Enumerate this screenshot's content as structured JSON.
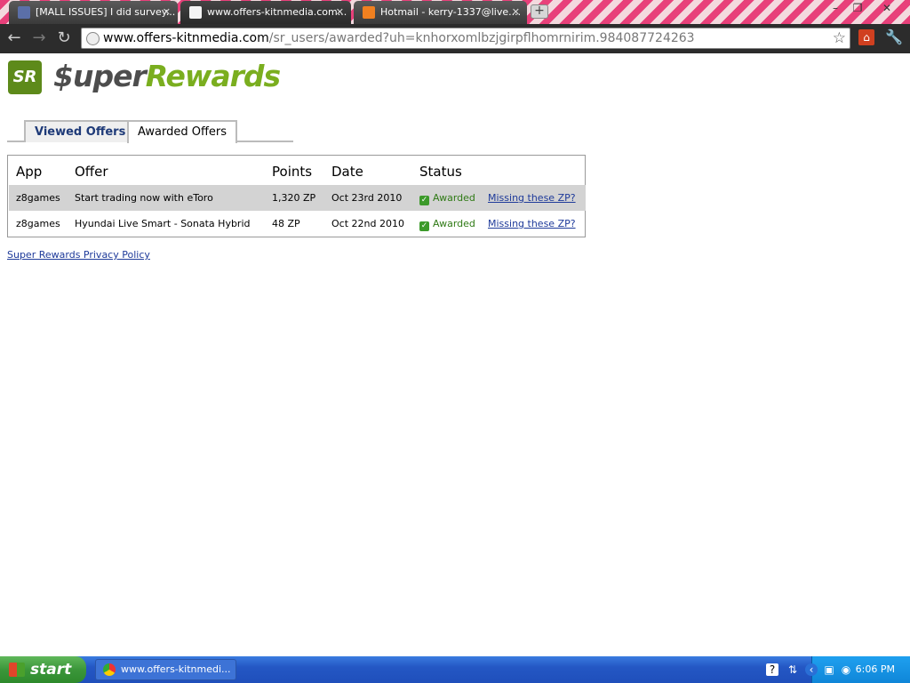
{
  "browser": {
    "tabs": [
      {
        "title": "[MALL ISSUES] I did survey...",
        "active": false
      },
      {
        "title": "www.offers-kitnmedia.com...",
        "active": true
      },
      {
        "title": "Hotmail - kerry-1337@live....",
        "active": false
      }
    ],
    "url_host": "www.offers-kitnmedia.com",
    "url_path": "/sr_users/awarded?uh=knhorxomlbzjgirpflhomrnirim.984087724263"
  },
  "logo": {
    "badge": "SR",
    "super": "$uper",
    "rewards": "Rewards"
  },
  "tabs": {
    "viewed": "Viewed Offers",
    "awarded": "Awarded Offers"
  },
  "table": {
    "headers": {
      "app": "App",
      "offer": "Offer",
      "points": "Points",
      "date": "Date",
      "status": "Status"
    },
    "rows": [
      {
        "app": "z8games",
        "offer": "Start trading now with eToro",
        "points": "1,320 ZP",
        "date": "Oct 23rd 2010",
        "status": "Awarded",
        "link": "Missing these ZP?"
      },
      {
        "app": "z8games",
        "offer": "Hyundai Live Smart - Sonata Hybrid",
        "points": "48 ZP",
        "date": "Oct 22nd 2010",
        "status": "Awarded",
        "link": "Missing these ZP?"
      }
    ]
  },
  "privacy_link": "Super Rewards Privacy Policy",
  "taskbar": {
    "start": "start",
    "task": "www.offers-kitnmedi...",
    "clock": "6:06 PM"
  },
  "colors": {
    "brand_green": "#7aae1f",
    "awarded_green": "#2f7a15",
    "link_blue": "#1e3a9a"
  }
}
